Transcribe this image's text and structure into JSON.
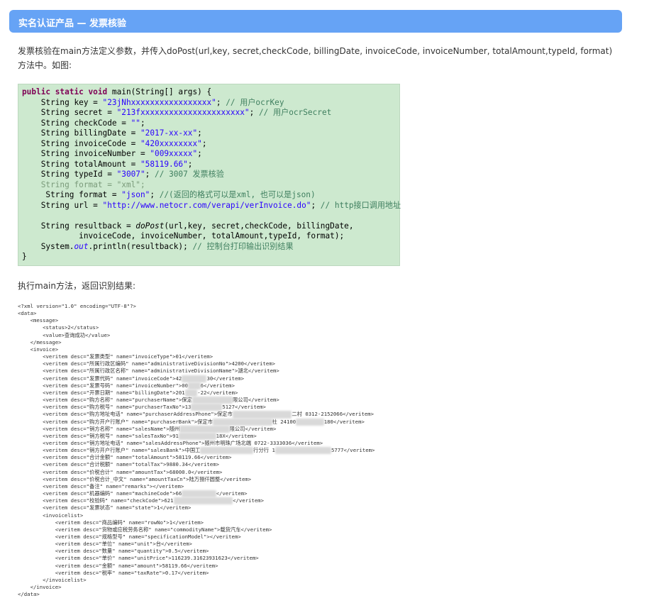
{
  "banner": {
    "title": "实名认证产品 — 发票核验"
  },
  "intro": "发票核验在main方法定义参数，并传入doPost(url,key, secret,checkCode, billingDate, invoiceCode, invoiceNumber, totalAmount,typeId, format) 方法中。如图:",
  "code": {
    "l1_kw": "public static void",
    "l1_rest": " main(String[] args) {",
    "l2_a": "    String key = ",
    "l2_s": "\"23jNhxxxxxxxxxxxxxxxxx\"",
    "l2_b": "; ",
    "l2_c": "// 用户ocrKey",
    "l3_a": "    String secret = ",
    "l3_s": "\"213fxxxxxxxxxxxxxxxxxxxxxx\"",
    "l3_b": "; ",
    "l3_c": "// 用户ocrSecret",
    "l4_a": "    String checkCode = ",
    "l4_s": "\"\"",
    "l4_b": ";",
    "l5_a": "    String billingDate = ",
    "l5_s": "\"2017-xx-xx\"",
    "l5_b": ";",
    "l6_a": "    String invoiceCode = ",
    "l6_s": "\"420xxxxxxxx\"",
    "l6_b": ";",
    "l7_a": "    String invoiceNumber = ",
    "l7_s": "\"009xxxxx\"",
    "l7_b": ";",
    "l8_a": "    String totalAmount = ",
    "l8_s": "\"58119.66\"",
    "l8_b": ";",
    "l9_a": "    String typeId = ",
    "l9_s": "\"3007\"",
    "l9_b": "; ",
    "l9_c": "// 3007 发票核验",
    "l10": "    String format = \"xml\";",
    "l11_a": "     String format = ",
    "l11_s": "\"json\"",
    "l11_b": "; ",
    "l11_c": "//(返回的格式可以是xml, 也可以是json)",
    "l12_a": "    String url = ",
    "l12_s": "\"http://www.netocr.com/verapi/verInvoice.do\"",
    "l12_b": "; ",
    "l12_c": "// http接口调用地址",
    "l13_a": "    String resultback = ",
    "l13_f": "doPost",
    "l13_b": "(url,key, secret,checkCode, billingDate,",
    "l14": "            invoiceCode, invoiceNumber, totalAmount,typeId, format);",
    "l15_a": "    System.",
    "l15_f": "out",
    "l15_b": ".println(resultback); ",
    "l15_c": "// 控制台打印输出识别结果",
    "l16": "}"
  },
  "result_label": "执行main方法，返回识别结果:",
  "xml": {
    "x01": "<?xml version=\"1.0\" encoding=\"UTF-8\"?>",
    "x02": "<data>",
    "x03": "    <message>",
    "x04": "        <status>2</status>",
    "x05": "        <value>查询成功</value>",
    "x06": "    </message>",
    "x07": "    <invoice>",
    "x08": "        <veritem desc=\"发票类型\" name=\"invoiceType\">01</veritem>",
    "x09": "        <veritem desc=\"所属行政区编码\" name=\"administrativeDivisionNo\">4200</veritem>",
    "x10": "        <veritem desc=\"所属行政区名称\" name=\"administrativeDivisionName\">湖北</veritem>",
    "x11a": "        <veritem desc=\"发票代码\" name=\"invoiceCode\">42",
    "x11b": "30</veritem>",
    "x12a": "        <veritem desc=\"发票号码\" name=\"invoiceNumber\">00",
    "x12b": "6</veritem>",
    "x13a": "        <veritem desc=\"开票日期\" name=\"billingDate\">201",
    "x13b": "-22</veritem>",
    "x14a": "        <veritem desc=\"购方名称\" name=\"purchaserName\">保定",
    "x14b": "限公司</veritem>",
    "x15a": "        <veritem desc=\"购方税号\" name=\"purchaserTaxNo\">13",
    "x15b": "5127</veritem>",
    "x16a": "        <veritem desc=\"购方地址电话\" name=\"purchaserAddressPhone\">保定市",
    "x16b": "二村 0312-2152066</veritem>",
    "x17a": "        <veritem desc=\"购方开户行账户\" name=\"purchaserBank\">保定市",
    "x17b": "社 24100",
    "x17c": "180</veritem>",
    "x18a": "        <veritem desc=\"销方名称\" name=\"salesName\">随州",
    "x18b": "限公司</veritem>",
    "x19a": "        <veritem desc=\"销方税号\" name=\"salesTaxNo\">91",
    "x19b": "18X</veritem>",
    "x20": "        <veritem desc=\"销方地址电话\" name=\"salesAddressPhone\">随州市明珠广场北端 0722-3333036</veritem>",
    "x21a": "        <veritem desc=\"销方开户行账户\" name=\"salesBank\">中国工",
    "x21b": "行分行 1",
    "x21c": "5777</veritem>",
    "x22": "        <veritem desc=\"合计金额\" name=\"totalAmount\">58119.66</veritem>",
    "x23": "        <veritem desc=\"合计税额\" name=\"totalTax\">9880.34</veritem>",
    "x24": "        <veritem desc=\"价税合计\" name=\"amountTax\">68000.0</veritem>",
    "x25": "        <veritem desc=\"价税合计_中文\" name=\"amountTaxCn\">陆万捌仟圆整</veritem>",
    "x26": "        <veritem desc=\"备注\" name=\"remarks\"></veritem>",
    "x27a": "        <veritem desc=\"机器编码\" name=\"machineCode\">66",
    "x27b": "</veritem>",
    "x28a": "        <veritem desc=\"校验码\" name=\"checkCode\">621",
    "x28b": "</veritem>",
    "x29": "        <veritem desc=\"发票状态\" name=\"state\">1</veritem>",
    "x30": "        <invoicelist>",
    "x31": "            <veritem desc=\"商品编码\" name=\"rowNo\">1</veritem>",
    "x32": "            <veritem desc=\"货物或应税劳务名称\" name=\"commodityName\">载货汽车</veritem>",
    "x33": "            <veritem desc=\"规格型号\" name=\"specificationModel\"></veritem>",
    "x34": "            <veritem desc=\"单位\" name=\"unit\">台</veritem>",
    "x35": "            <veritem desc=\"数量\" name=\"quantity\">0.5</veritem>",
    "x36": "            <veritem desc=\"单价\" name=\"unitPrice\">116239.31623931623</veritem>",
    "x37": "            <veritem desc=\"金额\" name=\"amount\">58119.66</veritem>",
    "x38": "            <veritem desc=\"税率\" name=\"taxRate\">0.17</veritem>",
    "x39": "        </invoicelist>",
    "x40": "    </invoice>",
    "x41": "</data>"
  }
}
